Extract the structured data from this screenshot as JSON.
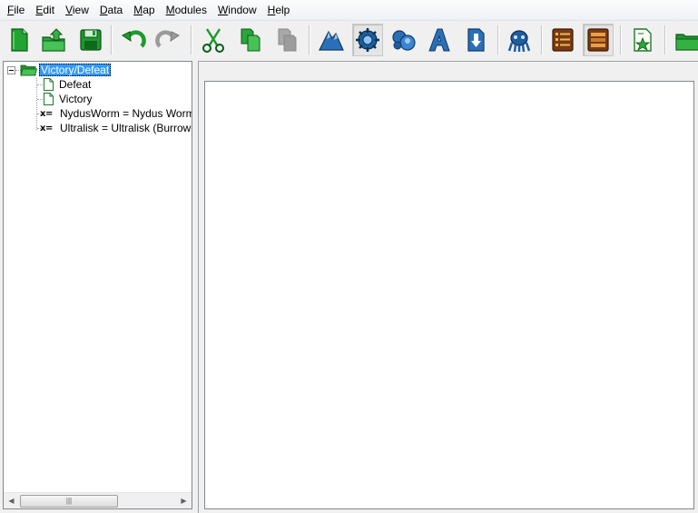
{
  "menu": [
    {
      "id": "file",
      "mnemonic": "F",
      "rest": "ile"
    },
    {
      "id": "edit",
      "mnemonic": "E",
      "rest": "dit"
    },
    {
      "id": "view",
      "mnemonic": "V",
      "rest": "iew"
    },
    {
      "id": "data",
      "mnemonic": "D",
      "rest": "ata"
    },
    {
      "id": "map",
      "mnemonic": "M",
      "rest": "ap"
    },
    {
      "id": "modules",
      "mnemonic": "M",
      "rest": "odules"
    },
    {
      "id": "window",
      "mnemonic": "W",
      "rest": "indow"
    },
    {
      "id": "help",
      "mnemonic": "H",
      "rest": "elp"
    }
  ],
  "toolbar_buttons": [
    {
      "name": "new-file-icon",
      "state": "normal"
    },
    {
      "name": "open-file-icon",
      "state": "normal"
    },
    {
      "name": "save-icon",
      "state": "normal"
    },
    {
      "name": "undo-icon",
      "state": "normal"
    },
    {
      "name": "redo-icon",
      "state": "disabled"
    },
    {
      "name": "cut-icon",
      "state": "normal"
    },
    {
      "name": "copy-icon",
      "state": "normal"
    },
    {
      "name": "paste-icon",
      "state": "disabled"
    },
    {
      "name": "terrain-icon",
      "state": "normal"
    },
    {
      "name": "triggers-icon",
      "state": "pressed"
    },
    {
      "name": "units-icon",
      "state": "normal"
    },
    {
      "name": "text-icon",
      "state": "normal"
    },
    {
      "name": "import-icon",
      "state": "normal"
    },
    {
      "name": "creature-icon",
      "state": "normal"
    },
    {
      "name": "list-icon",
      "state": "normal"
    },
    {
      "name": "list-panel-icon",
      "state": "pressed"
    },
    {
      "name": "script-icon",
      "state": "normal"
    },
    {
      "name": "folder-icon",
      "state": "normal"
    }
  ],
  "colors": {
    "selection": "#3399ff",
    "icon_green": "#1e9a2c",
    "icon_blue": "#2a6fb8",
    "icon_brown": "#7a3a12"
  },
  "tree": {
    "root": {
      "label": "Victory/Defeat",
      "icon": "folder-open-icon",
      "expanded": true,
      "selected": true
    },
    "children": [
      {
        "label": "Defeat",
        "icon": "document-icon"
      },
      {
        "label": "Victory",
        "icon": "document-icon"
      },
      {
        "label": "NydusWorm = Nydus Worm (Ca",
        "icon": "variable-icon",
        "icon_text": "x="
      },
      {
        "label": "Ultralisk = Ultralisk  (Burrowed) (",
        "icon": "variable-icon",
        "icon_text": "x="
      }
    ]
  },
  "scrollbar": {
    "grip": "|||"
  }
}
